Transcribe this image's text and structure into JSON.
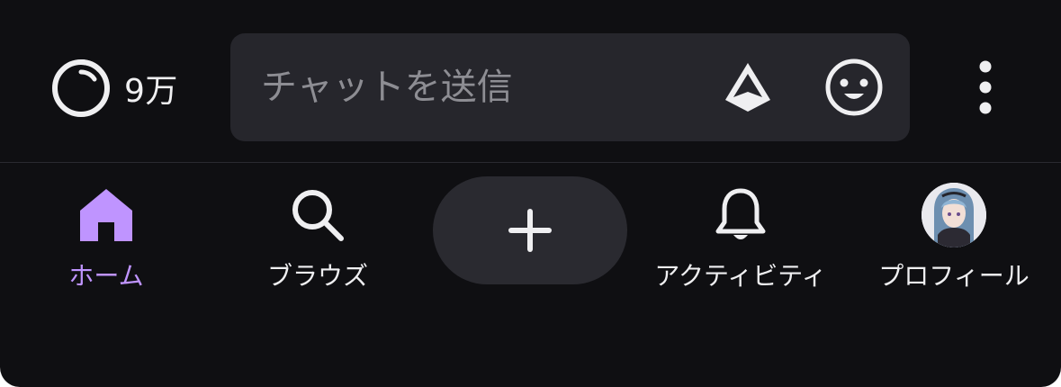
{
  "chat_bar": {
    "viewer_count": "9万",
    "chat_input": {
      "value": "",
      "placeholder": "チャットを送信"
    },
    "icons": [
      "viewers-ring-icon",
      "bits-icon",
      "emote-icon",
      "more-vertical-icon"
    ]
  },
  "bottom_nav": {
    "items": [
      {
        "label": "ホーム",
        "icon": "home-icon",
        "active": true
      },
      {
        "label": "ブラウズ",
        "icon": "search-icon",
        "active": false
      },
      {
        "label": "",
        "icon": "plus-icon",
        "active": false
      },
      {
        "label": "アクティビティ",
        "icon": "bell-icon",
        "active": false
      },
      {
        "label": "プロフィール",
        "icon": "avatar",
        "active": false
      }
    ]
  },
  "colors": {
    "background": "#0f0f12",
    "input_background": "#26262c",
    "accent": "#bf94ff",
    "text": "#efeff1",
    "placeholder": "#8d8d93",
    "create_button": "#2a2a30"
  }
}
